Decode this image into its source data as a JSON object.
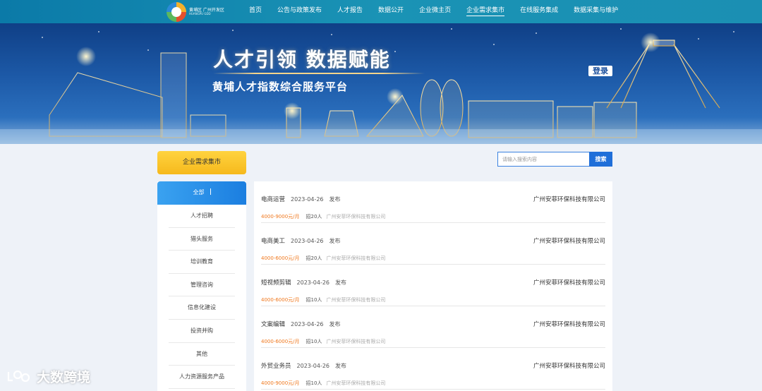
{
  "header": {
    "logo": {
      "line1": "黄埔区 广州开发区",
      "line2": "HUANGPU GDD"
    },
    "nav": [
      {
        "label": "首页",
        "active": false
      },
      {
        "label": "公告与政策发布",
        "active": false
      },
      {
        "label": "人才报告",
        "active": false
      },
      {
        "label": "数据公开",
        "active": false
      },
      {
        "label": "企业微主页",
        "active": false
      },
      {
        "label": "企业需求集市",
        "active": true
      },
      {
        "label": "在线服务集成",
        "active": false
      },
      {
        "label": "数据采集与维护",
        "active": false
      }
    ]
  },
  "banner": {
    "title": "人才引领 数据赋能",
    "subtitle": "黄埔人才指数综合服务平台",
    "login_label": "登录"
  },
  "market_button": "企业需求集市",
  "sidebar": {
    "items": [
      {
        "label": "全部",
        "active": true
      },
      {
        "label": "人才招聘",
        "active": false
      },
      {
        "label": "猎头服务",
        "active": false
      },
      {
        "label": "培训教育",
        "active": false
      },
      {
        "label": "管理咨询",
        "active": false
      },
      {
        "label": "信息化建设",
        "active": false
      },
      {
        "label": "投资并购",
        "active": false
      },
      {
        "label": "其他",
        "active": false
      },
      {
        "label": "人力资源服务产品",
        "active": false
      }
    ]
  },
  "search": {
    "placeholder": "请输入搜索内容",
    "button_label": "搜索"
  },
  "jobs": [
    {
      "title": "电商运营",
      "date": "2023-04-26",
      "status": "发布",
      "company": "广州安菲环保科技有限公司",
      "salary": "4000-9000元/月",
      "count": "招20人"
    },
    {
      "title": "电商美工",
      "date": "2023-04-26",
      "status": "发布",
      "company": "广州安菲环保科技有限公司",
      "salary": "4000-6000元/月",
      "count": "招20人"
    },
    {
      "title": "短视频剪辑",
      "date": "2023-04-26",
      "status": "发布",
      "company": "广州安菲环保科技有限公司",
      "salary": "4000-6000元/月",
      "count": "招10人"
    },
    {
      "title": "文案编辑",
      "date": "2023-04-26",
      "status": "发布",
      "company": "广州安菲环保科技有限公司",
      "salary": "4000-6000元/月",
      "count": "招10人"
    },
    {
      "title": "外贸业务员",
      "date": "2023-04-26",
      "status": "发布",
      "company": "广州安菲环保科技有限公司",
      "salary": "4000-9000元/月",
      "count": "招10人"
    }
  ],
  "watermark": "大数跨境",
  "colors": {
    "nav_bg": "#1a8fb4",
    "accent_blue": "#1f6fd9",
    "salary_orange": "#f0781e",
    "yellow": "#f6b91c"
  }
}
